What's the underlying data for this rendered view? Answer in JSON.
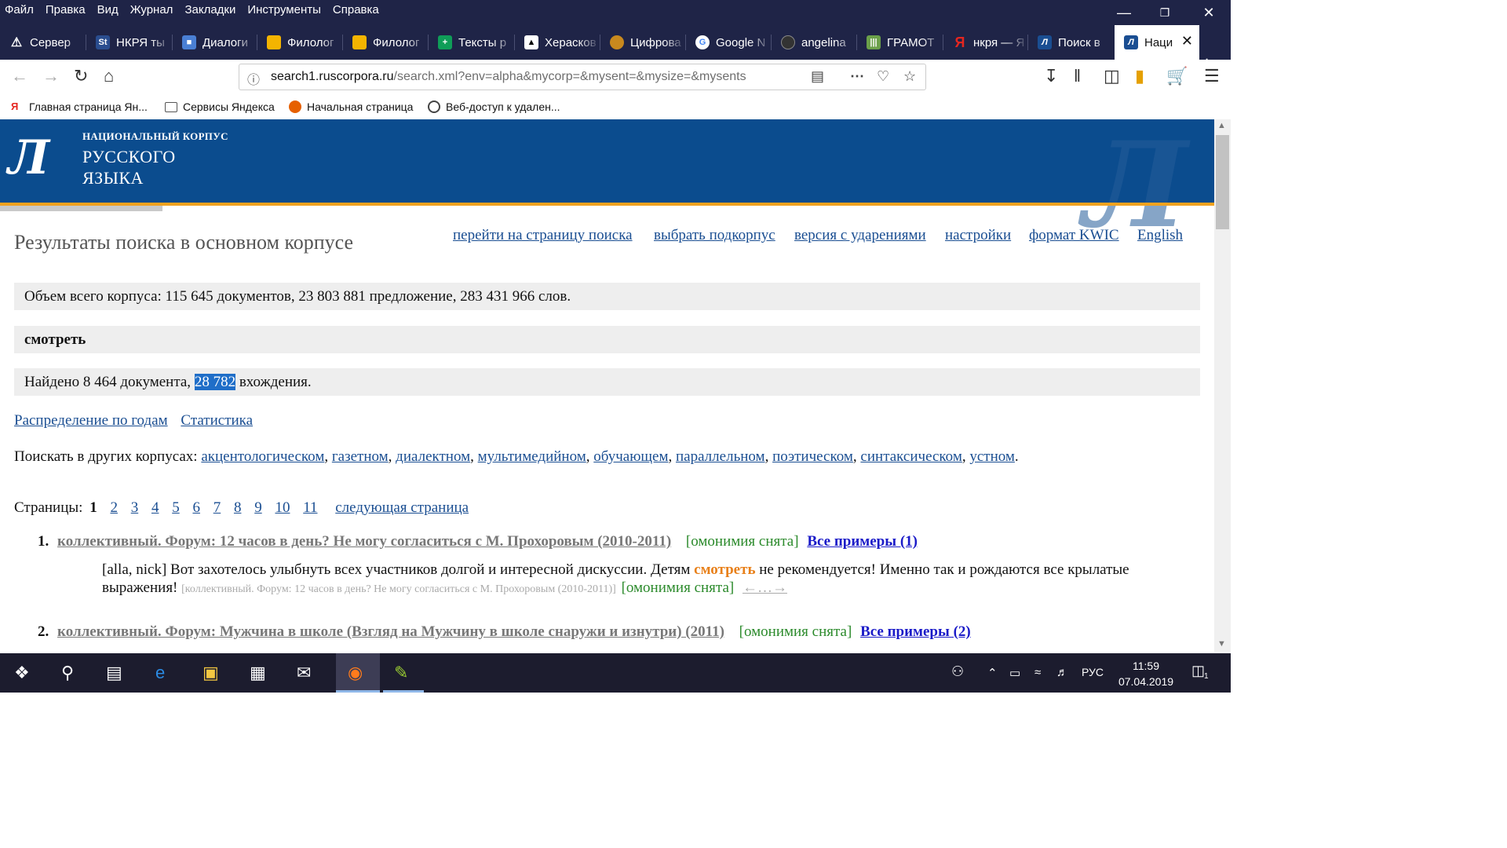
{
  "menubar": {
    "items": [
      "Файл",
      "Правка",
      "Вид",
      "Журнал",
      "Закладки",
      "Инструменты",
      "Справка"
    ]
  },
  "tabs": [
    {
      "title": "Сервер",
      "icon": "warning-icon"
    },
    {
      "title": "НКРЯ ты",
      "icon": "st-icon"
    },
    {
      "title": "Диалоги",
      "icon": "chat-icon"
    },
    {
      "title": "Филолог",
      "icon": "slides-icon"
    },
    {
      "title": "Филолог",
      "icon": "slides-icon"
    },
    {
      "title": "Тексты р",
      "icon": "sheets-icon"
    },
    {
      "title": "Херасков",
      "icon": "bookmark-icon"
    },
    {
      "title": "Цифрова",
      "icon": "globe-icon"
    },
    {
      "title": "Google N",
      "icon": "google-icon"
    },
    {
      "title": "angelina",
      "icon": "github-icon"
    },
    {
      "title": "ГРАМОТ",
      "icon": "gramota-icon"
    },
    {
      "title": "нкря — Я",
      "icon": "yandex-icon"
    },
    {
      "title": "Поиск в",
      "icon": "ruscorpora-icon"
    },
    {
      "title": "Наци",
      "icon": "ruscorpora-icon"
    }
  ],
  "url": {
    "host": "search1.ruscorpora.ru",
    "path": "/search.xml?env=alpha&mycorp=&mysent=&mysize=&mysents"
  },
  "bookmarks": [
    {
      "label": "Главная страница Ян...",
      "icon": "yandex-icon"
    },
    {
      "label": "Сервисы Яндекса",
      "icon": "folder-icon"
    },
    {
      "label": "Начальная страница",
      "icon": "firefox-icon"
    },
    {
      "label": "Веб-доступ к удален...",
      "icon": "globe-icon"
    }
  ],
  "header": {
    "small": "НАЦИОНАЛЬНЫЙ КОРПУС",
    "line1": "РУССКОГО",
    "line2": "ЯЗЫКА"
  },
  "page": {
    "title": "Результаты поиска в основном корпусе",
    "links": [
      "перейти на страницу поиска",
      "выбрать подкорпус",
      "версия с ударениями",
      "настройки",
      "формат KWIC",
      "English"
    ],
    "corpus_size": "Объем всего корпуса: 115 645 документов, 23 803 881 предложение, 283 431 966 слов.",
    "query": "смотреть",
    "found_prefix": "Найдено 8 464 документа, ",
    "found_highlight": "28 782",
    "found_suffix": " вхождения.",
    "dist_link": "Распределение по годам",
    "stat_link": "Статистика",
    "other_label": "Поискать в других корпусах:",
    "other_corpora": [
      "акцентологическом",
      "газетном",
      "диалектном",
      "мультимедийном",
      "обучающем",
      "параллельном",
      "поэтическом",
      "синтаксическом",
      "устном"
    ],
    "pages_label": "Страницы:",
    "current_page": "1",
    "pages": [
      "2",
      "3",
      "4",
      "5",
      "6",
      "7",
      "8",
      "9",
      "10",
      "11"
    ],
    "next_page": "следующая страница"
  },
  "results": [
    {
      "num": "1.",
      "doc": "коллективный. Форум: 12 часов в день? Не могу согласиться с М. Прохоровым (2010-2011)",
      "homonymy": "[омонимия снята]",
      "all_examples": "Все примеры (1)",
      "snippet_before": "[alla, nick] Вот захотелось улыбнуть всех участников долгой и интересной дискуссии. Детям ",
      "keyword": "смотреть",
      "snippet_after": " не рекомендуется! Именно так и рождаются все крылатые выражения! ",
      "source": "[коллективный. Форум: 12 часов в день? Не могу согласиться с М. Прохоровым (2010-2011)]",
      "arrows": "←…→"
    },
    {
      "num": "2.",
      "doc": "коллективный. Форум: Мужчина в школе (Взгляд на Мужчину в школе снаружи и изнутри) (2011)",
      "homonymy": "[омонимия снята]",
      "all_examples": "Все примеры (2)"
    }
  ],
  "taskbar": {
    "time": "11:59",
    "date": "07.04.2019",
    "lang": "РУС",
    "notifications": "1"
  }
}
